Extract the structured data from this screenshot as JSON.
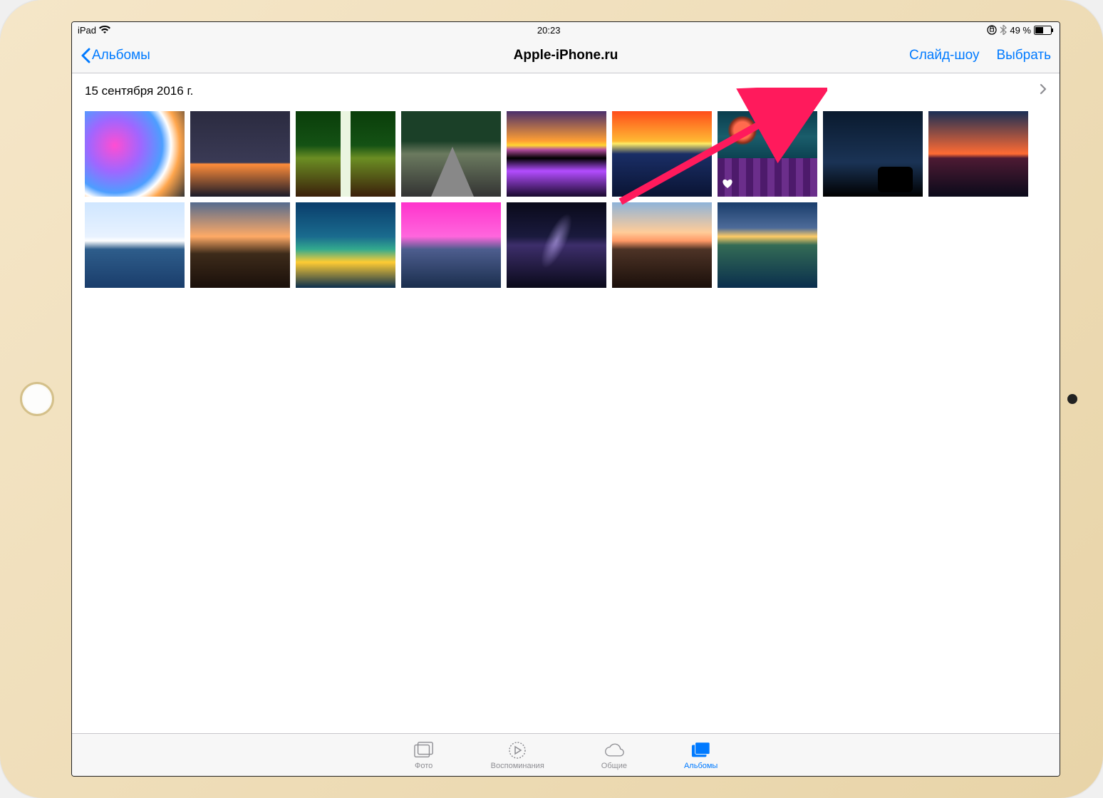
{
  "status_bar": {
    "device": "iPad",
    "time": "20:23",
    "battery_pct": "49 %"
  },
  "nav": {
    "back_label": "Альбомы",
    "title": "Apple-iPhone.ru",
    "slideshow": "Слайд-шоу",
    "select": "Выбрать"
  },
  "section": {
    "date": "15 сентября 2016 г."
  },
  "photos": [
    {
      "name": "colorful-clouds",
      "favorite": false
    },
    {
      "name": "city-night",
      "favorite": false
    },
    {
      "name": "forest-path",
      "favorite": false
    },
    {
      "name": "forest-road",
      "favorite": false
    },
    {
      "name": "sunset-field",
      "favorite": false
    },
    {
      "name": "ocean-sunset",
      "favorite": false
    },
    {
      "name": "lavender-tree",
      "favorite": true
    },
    {
      "name": "motorcycle-night",
      "favorite": false
    },
    {
      "name": "sea-sunset",
      "favorite": false
    },
    {
      "name": "snow-mountain-lake",
      "favorite": false
    },
    {
      "name": "orange-peaks",
      "favorite": false
    },
    {
      "name": "coral-reef",
      "favorite": false
    },
    {
      "name": "pink-mountain",
      "favorite": false
    },
    {
      "name": "milky-way",
      "favorite": false
    },
    {
      "name": "volcano-sunrise",
      "favorite": false
    },
    {
      "name": "mountain-reflection",
      "favorite": false
    }
  ],
  "tabs": [
    {
      "id": "photos",
      "label": "Фото",
      "active": false
    },
    {
      "id": "memories",
      "label": "Воспоминания",
      "active": false
    },
    {
      "id": "shared",
      "label": "Общие",
      "active": false
    },
    {
      "id": "albums",
      "label": "Альбомы",
      "active": true
    }
  ],
  "colors": {
    "tint": "#007aff"
  }
}
